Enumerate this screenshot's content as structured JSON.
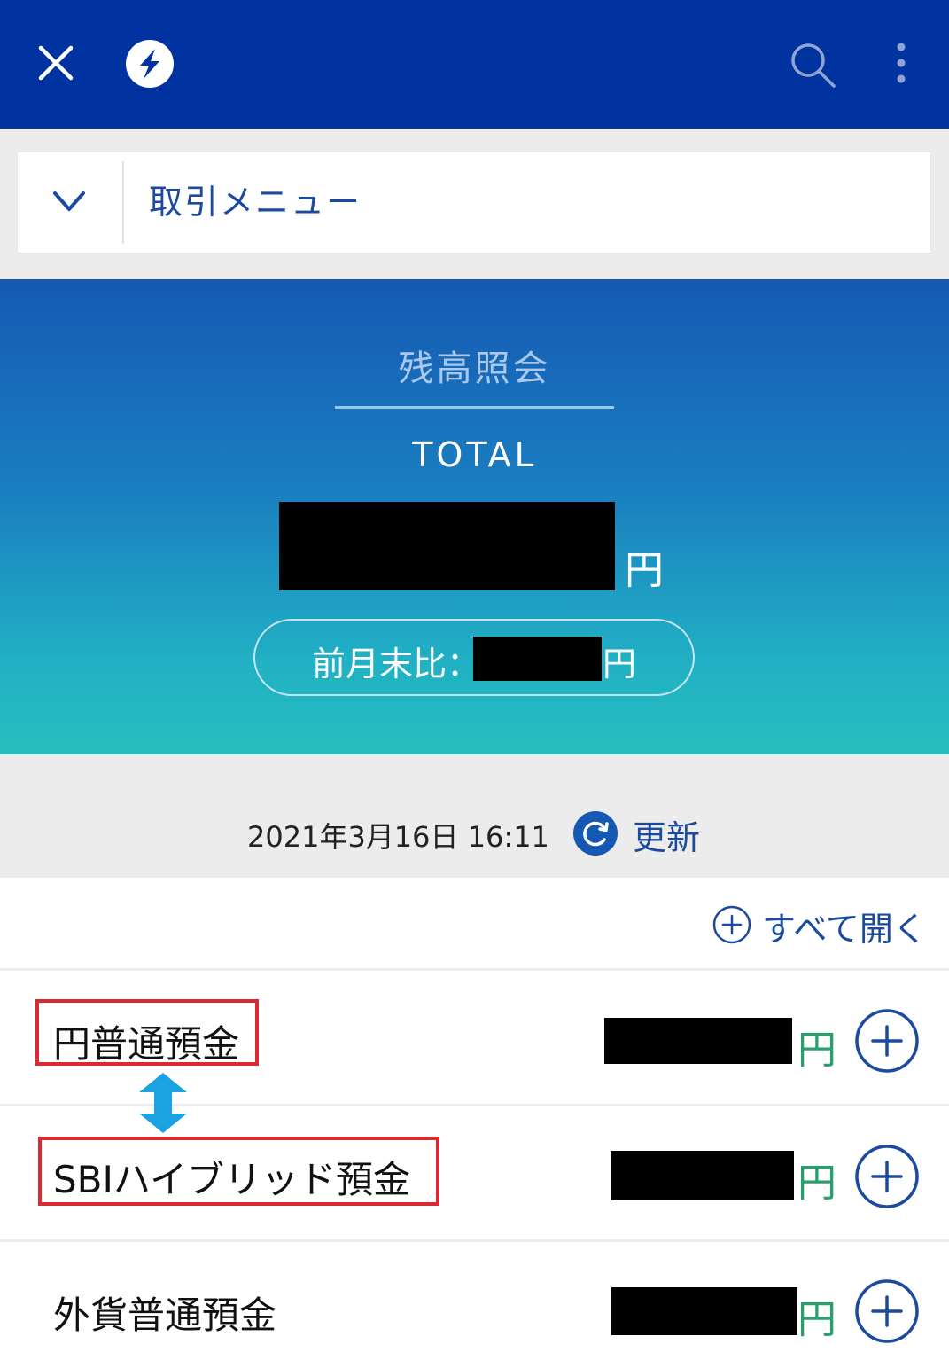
{
  "header": {
    "close_icon": "close-icon",
    "logo_icon": "bank-logo-icon",
    "search_icon": "search-icon",
    "menu_icon": "more-vertical-icon",
    "bg_color": "#0033a0"
  },
  "transaction_menu": {
    "label": "取引メニュー",
    "icon": "chevron-down-icon"
  },
  "balance": {
    "title": "残高照会",
    "total_label": "TOTAL",
    "total_amount": "",
    "currency": "円",
    "monthly_compare_label": "前月末比：",
    "monthly_compare_amount": "",
    "monthly_compare_currency": "円"
  },
  "update": {
    "datetime": "2021年3月16日 16:11",
    "label": "更新",
    "icon": "refresh-icon"
  },
  "expand_all": {
    "label": "すべて開く",
    "icon": "plus-circle-icon"
  },
  "accounts": [
    {
      "name": "円普通預金",
      "amount": "",
      "currency": "円"
    },
    {
      "name": "SBIハイブリッド預金",
      "amount": "",
      "currency": "円"
    },
    {
      "name": "外貨普通預金",
      "amount": "",
      "currency": "円"
    }
  ],
  "colors": {
    "accent": "#1b4a9e",
    "yen_green": "#27a06b",
    "highlight_red": "#d82a32",
    "arrow_blue": "#1aa3e0"
  }
}
